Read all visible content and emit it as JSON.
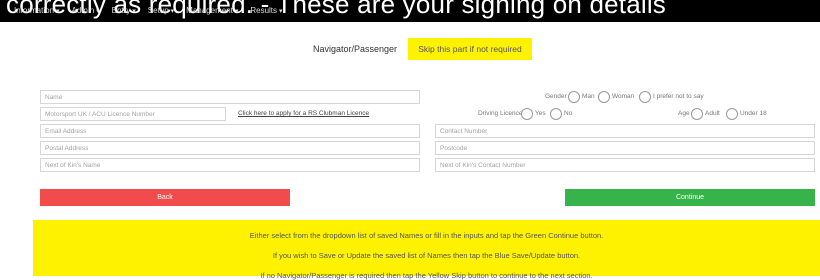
{
  "banner": {
    "text": "correctly as required.   -   These are your signing on details"
  },
  "nav": {
    "items": [
      "Information",
      "Admin",
      "Entry",
      "Setup",
      "Management",
      "Results"
    ]
  },
  "header": {
    "title": "Navigator/Passenger",
    "skip_label": "Skip this part if not required"
  },
  "form": {
    "name_placeholder": "Name",
    "licence_placeholder": "Motorsport UK / ACU Licence Number",
    "licence_link": "Click here to apply for a RS Clubman Licence",
    "email_placeholder": "Email Address",
    "postal_placeholder": "Postal Address",
    "next_of_kin_placeholder": "Next of Kin's Name",
    "contact_placeholder": "Contact Number",
    "postcode_placeholder": "Postcode",
    "next_of_kin_contact_placeholder": "Next of Kin's Contact Number",
    "gender_label": "Gender",
    "gender_options": [
      "Man",
      "Woman",
      "I prefer not to say"
    ],
    "driving_licence_label": "Driving Licence",
    "driving_licence_options": [
      "Yes",
      "No"
    ],
    "age_label": "Age",
    "age_options": [
      "Adult",
      "Under 18"
    ]
  },
  "buttons": {
    "back": "Back",
    "continue": "Continue"
  },
  "info": {
    "line1": "Either select from the dropdown list of saved Names or fill in the inputs and tap the Green Continue button.",
    "line2": "If you wish to Save or Update the saved list of Names then tap the Blue Save/Update button.",
    "line3": "If no Navigator/Passenger is required then tap the Yellow Skip button to continue to the next section."
  }
}
